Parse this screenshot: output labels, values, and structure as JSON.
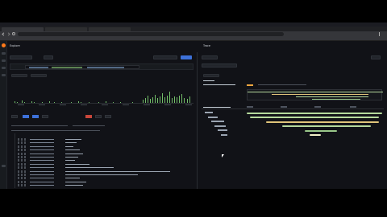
{
  "panel_left": {
    "title": "Explore"
  },
  "panel_right": {
    "title": "Trace"
  },
  "colors": {
    "accent": "#3d71d9",
    "graph_green": "#73bf69",
    "trace_orange": "#f0a640",
    "span_green": "#b5d99c"
  },
  "icons": [
    "grafana-logo-icon",
    "search-icon",
    "star-icon",
    "compass-icon",
    "alert-icon",
    "gear-icon",
    "back-icon",
    "forward-icon",
    "refresh-icon",
    "menu-icon"
  ]
}
